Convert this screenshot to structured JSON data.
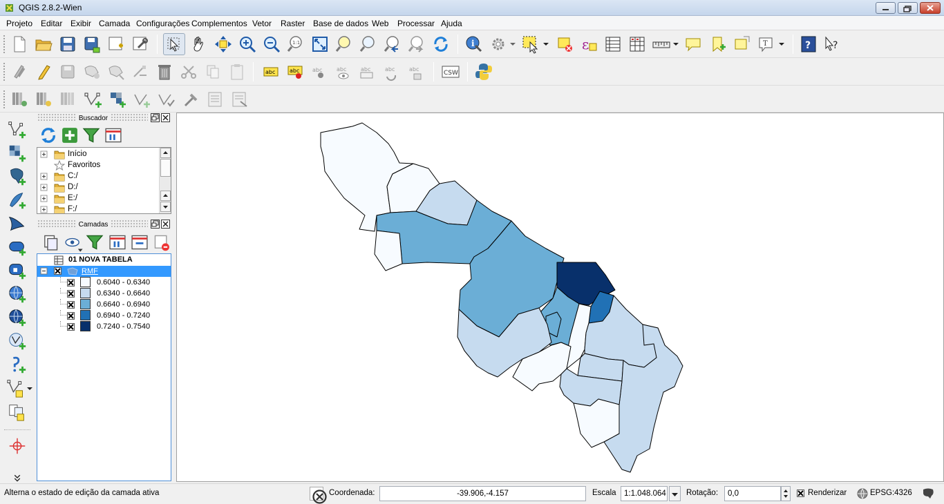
{
  "window": {
    "title": "QGIS 2.8.2-Wien"
  },
  "menu": [
    "Projeto",
    "Editar",
    "Exibir",
    "Camada",
    "Configurações",
    "Complementos",
    "Vetor",
    "Raster",
    "Base de dados",
    "Web",
    "Processar",
    "Ajuda"
  ],
  "toolbars": {
    "row1": [
      "new-project-icon",
      "open-project-icon",
      "save-project-icon",
      "save-as-icon",
      "new-print-composer-icon",
      "composer-manager-icon",
      "pan-selection-icon",
      "pan-hand-icon",
      "pan-to-selection-icon",
      "zoom-in-icon",
      "zoom-out-icon",
      "zoom-native-icon",
      "zoom-full-icon",
      "zoom-to-selection-icon",
      "zoom-to-layer-icon",
      "zoom-last-icon",
      "zoom-next-icon",
      "refresh-icon",
      "identify-icon",
      "action-gear-icon",
      "select-features-icon",
      "deselect-icon",
      "expression-icon",
      "attribute-table-icon",
      "field-calculator-icon",
      "measure-icon",
      "map-tip-icon",
      "new-bookmark-icon",
      "show-bookmarks-icon",
      "text-annotation-icon",
      "help-icon",
      "whats-this-icon"
    ],
    "row2_labels": {
      "csw": "CSW",
      "abc": "abc"
    },
    "row3": [
      "digitize-1-icon",
      "digitize-2-icon",
      "digitize-3-icon",
      "digitize-4-icon",
      "digitize-5-icon",
      "digitize-6-icon",
      "digitize-7-icon",
      "digitize-8-icon",
      "digitize-9-icon",
      "digitize-10-icon"
    ]
  },
  "browser_panel": {
    "title": "Buscador",
    "items": [
      {
        "label": "Início",
        "icon": "folder-icon"
      },
      {
        "label": "Favoritos",
        "icon": "star-icon"
      },
      {
        "label": "C:/",
        "icon": "folder-icon"
      },
      {
        "label": "D:/",
        "icon": "folder-icon"
      },
      {
        "label": "E:/",
        "icon": "folder-icon"
      },
      {
        "label": "F:/",
        "icon": "folder-icon"
      }
    ]
  },
  "layers_panel": {
    "title": "Camadas",
    "layers": [
      {
        "name": "01 NOVA TABELA",
        "type": "table"
      },
      {
        "name": "RMF",
        "type": "polygon",
        "selected": true
      }
    ],
    "legend": [
      {
        "label": "0.6040 - 0.6340",
        "color": "#f7fbff"
      },
      {
        "label": "0.6340 - 0.6640",
        "color": "#c6dbef"
      },
      {
        "label": "0.6640 - 0.6940",
        "color": "#6baed6"
      },
      {
        "label": "0.6940 - 0.7240",
        "color": "#2171b5"
      },
      {
        "label": "0.7240 - 0.7540",
        "color": "#08306b"
      }
    ]
  },
  "statusbar": {
    "message": "Alterna o estado de edição da camada ativa",
    "coord_label": "Coordenada:",
    "coord_value": "-39.906,-4.157",
    "scale_label": "Escala",
    "scale_value": "1:1.048.064",
    "rotation_label": "Rotação:",
    "rotation_value": "0,0",
    "render_label": "Renderizar",
    "crs_label": "EPSG:4326"
  }
}
